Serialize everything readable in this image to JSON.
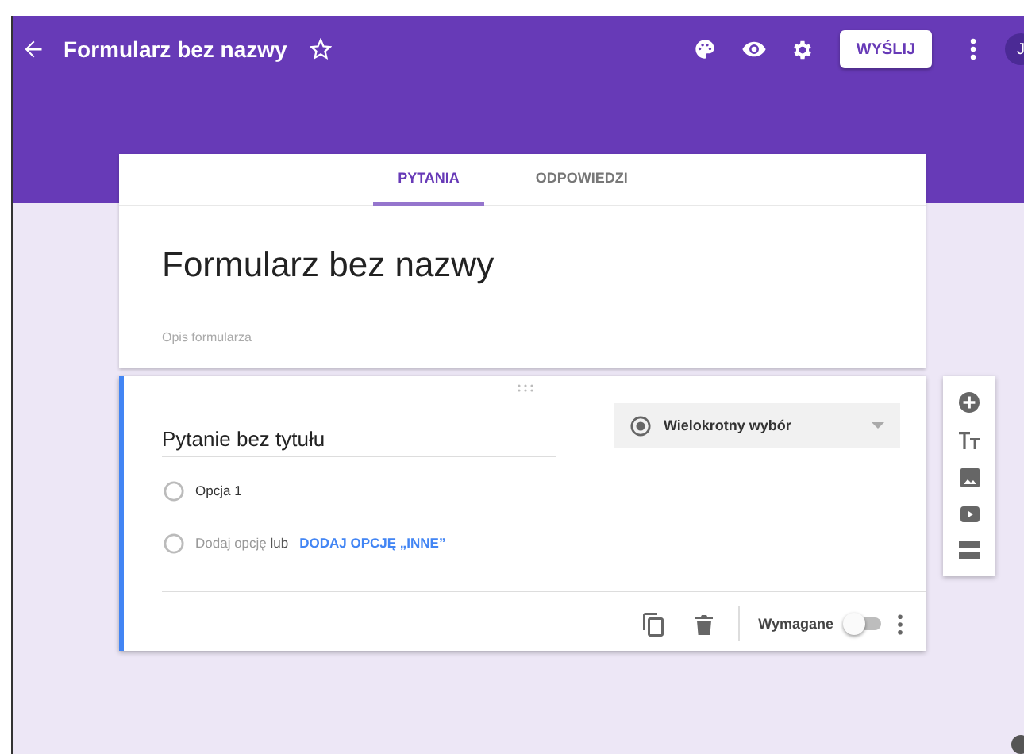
{
  "app_bar": {
    "title": "Formularz bez nazwy",
    "starred": false,
    "send_button": "WYŚLIJ",
    "avatar": "J"
  },
  "tabs": [
    {
      "label": "PYTANIA",
      "selected": true
    },
    {
      "label": "ODPOWIEDZI",
      "selected": false
    }
  ],
  "form": {
    "title": "Formularz bez nazwy",
    "description": {
      "placeholder": "Opis formularza"
    }
  },
  "question": {
    "title": "Pytanie bez tytułu",
    "type": "Wielokrotny wybór",
    "options": [
      {
        "label": "Opcja 1"
      }
    ],
    "add_option": {
      "text": "Dodaj opcję",
      "separator": "lub",
      "other_link": "DODAJ OPCJĘ „INNE”"
    },
    "required_label": "Wymagane",
    "required": false
  }
}
